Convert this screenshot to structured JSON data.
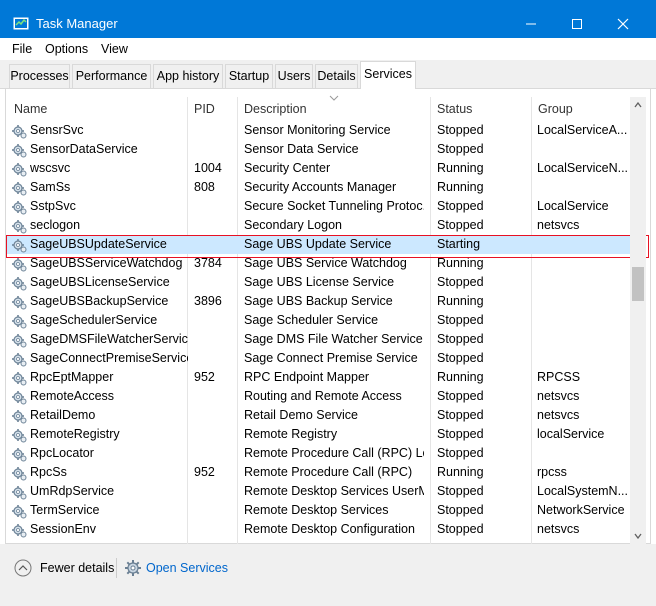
{
  "window": {
    "title": "Task Manager",
    "accent_color": "#0078d7",
    "icon": "task-manager-icon"
  },
  "menu": [
    "File",
    "Options",
    "View"
  ],
  "tabs": [
    "Processes",
    "Performance",
    "App history",
    "Startup",
    "Users",
    "Details",
    "Services"
  ],
  "active_tab": "Services",
  "columns": [
    "Name",
    "PID",
    "Description",
    "Status",
    "Group"
  ],
  "rows": [
    {
      "name": "SensrSvc",
      "pid": "",
      "description": "Sensor Monitoring Service",
      "status": "Stopped",
      "group": "LocalServiceA..."
    },
    {
      "name": "SensorDataService",
      "pid": "",
      "description": "Sensor Data Service",
      "status": "Stopped",
      "group": ""
    },
    {
      "name": "wscsvc",
      "pid": "1004",
      "description": "Security Center",
      "status": "Running",
      "group": "LocalServiceN..."
    },
    {
      "name": "SamSs",
      "pid": "808",
      "description": "Security Accounts Manager",
      "status": "Running",
      "group": ""
    },
    {
      "name": "SstpSvc",
      "pid": "",
      "description": "Secure Socket Tunneling Protoc...",
      "status": "Stopped",
      "group": "LocalService"
    },
    {
      "name": "seclogon",
      "pid": "",
      "description": "Secondary Logon",
      "status": "Stopped",
      "group": "netsvcs"
    },
    {
      "name": "SageUBSUpdateService",
      "pid": "",
      "description": "Sage UBS Update Service",
      "status": "Starting",
      "group": ""
    },
    {
      "name": "SageUBSServiceWatchdog",
      "pid": "3784",
      "description": "Sage UBS Service Watchdog",
      "status": "Running",
      "group": ""
    },
    {
      "name": "SageUBSLicenseService",
      "pid": "",
      "description": "Sage UBS License Service",
      "status": "Stopped",
      "group": ""
    },
    {
      "name": "SageUBSBackupService",
      "pid": "3896",
      "description": "Sage UBS Backup Service",
      "status": "Running",
      "group": ""
    },
    {
      "name": "SageSchedulerService",
      "pid": "",
      "description": "Sage Scheduler Service",
      "status": "Stopped",
      "group": ""
    },
    {
      "name": "SageDMSFileWatcherService",
      "pid": "",
      "description": "Sage DMS File Watcher Service",
      "status": "Stopped",
      "group": ""
    },
    {
      "name": "SageConnectPremiseService",
      "pid": "",
      "description": "Sage Connect Premise Service",
      "status": "Stopped",
      "group": ""
    },
    {
      "name": "RpcEptMapper",
      "pid": "952",
      "description": "RPC Endpoint Mapper",
      "status": "Running",
      "group": "RPCSS"
    },
    {
      "name": "RemoteAccess",
      "pid": "",
      "description": "Routing and Remote Access",
      "status": "Stopped",
      "group": "netsvcs"
    },
    {
      "name": "RetailDemo",
      "pid": "",
      "description": "Retail Demo Service",
      "status": "Stopped",
      "group": "netsvcs"
    },
    {
      "name": "RemoteRegistry",
      "pid": "",
      "description": "Remote Registry",
      "status": "Stopped",
      "group": "localService"
    },
    {
      "name": "RpcLocator",
      "pid": "",
      "description": "Remote Procedure Call (RPC) Lo...",
      "status": "Stopped",
      "group": ""
    },
    {
      "name": "RpcSs",
      "pid": "952",
      "description": "Remote Procedure Call (RPC)",
      "status": "Running",
      "group": "rpcss"
    },
    {
      "name": "UmRdpService",
      "pid": "",
      "description": "Remote Desktop Services UserM...",
      "status": "Stopped",
      "group": "LocalSystemN..."
    },
    {
      "name": "TermService",
      "pid": "",
      "description": "Remote Desktop Services",
      "status": "Stopped",
      "group": "NetworkService"
    },
    {
      "name": "SessionEnv",
      "pid": "",
      "description": "Remote Desktop Configuration",
      "status": "Stopped",
      "group": "netsvcs"
    }
  ],
  "selected_row": "SageUBSUpdateService",
  "footer": {
    "fewer_details": "Fewer details",
    "open_services": "Open Services"
  },
  "colors": {
    "selection": "#cce8ff",
    "highlight_border": "#e81123",
    "link": "#0066cc"
  }
}
